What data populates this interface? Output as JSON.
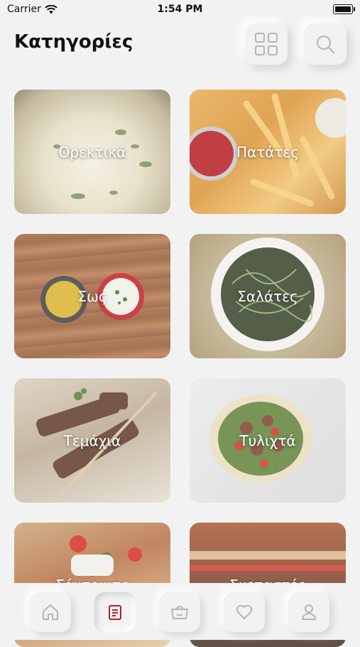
{
  "status_bar": {
    "carrier": "Carrier",
    "time": "1:54 PM"
  },
  "header": {
    "title": "Κατηγορίες"
  },
  "categories": [
    {
      "label": "Ορεκτικά"
    },
    {
      "label": "Πατάτες"
    },
    {
      "label": "Σως"
    },
    {
      "label": "Σαλάτες"
    },
    {
      "label": "Τεμάχια"
    },
    {
      "label": "Τυλιχτά"
    },
    {
      "label": "Σάντουιτς"
    },
    {
      "label": "Σκεπαστές"
    }
  ],
  "tabbar": {
    "items": [
      {
        "icon": "home-icon"
      },
      {
        "icon": "menu-card-icon",
        "active": true
      },
      {
        "icon": "basket-icon"
      },
      {
        "icon": "heart-icon"
      },
      {
        "icon": "profile-icon"
      }
    ]
  },
  "colors": {
    "background": "#f2f2f2",
    "accent": "#b22222",
    "icon": "#b5b5b5"
  }
}
